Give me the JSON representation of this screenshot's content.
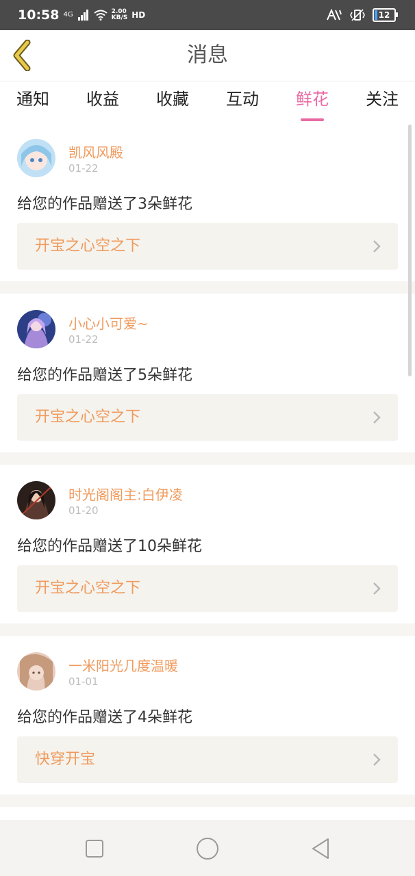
{
  "status_bar": {
    "time": "10:58",
    "network": "4G",
    "speed_value": "2.00",
    "speed_unit": "KB/S",
    "hd": "HD",
    "battery": "12"
  },
  "header": {
    "title": "消息"
  },
  "tabs": [
    {
      "label": "通知"
    },
    {
      "label": "收益"
    },
    {
      "label": "收藏"
    },
    {
      "label": "互动"
    },
    {
      "label": "鲜花",
      "active": true
    },
    {
      "label": "关注"
    }
  ],
  "messages": [
    {
      "user": "凯风风殿",
      "date": "01-22",
      "text": "给您的作品赠送了3朵鲜花",
      "work": "开宝之心空之下"
    },
    {
      "user": "小心小可爱~",
      "date": "01-22",
      "text": "给您的作品赠送了5朵鲜花",
      "work": "开宝之心空之下"
    },
    {
      "user": "时光阁阁主:白伊凌",
      "date": "01-20",
      "text": "给您的作品赠送了10朵鲜花",
      "work": "开宝之心空之下"
    },
    {
      "user": "一米阳光几度温暖",
      "date": "01-01",
      "text": "给您的作品赠送了4朵鲜花",
      "work": "快穿开宝"
    }
  ],
  "colors": {
    "accent_tab": "#e96ba4",
    "username": "#f09a5c",
    "back_arrow": "#e8c94a",
    "work_bg": "#f4f3ee"
  }
}
